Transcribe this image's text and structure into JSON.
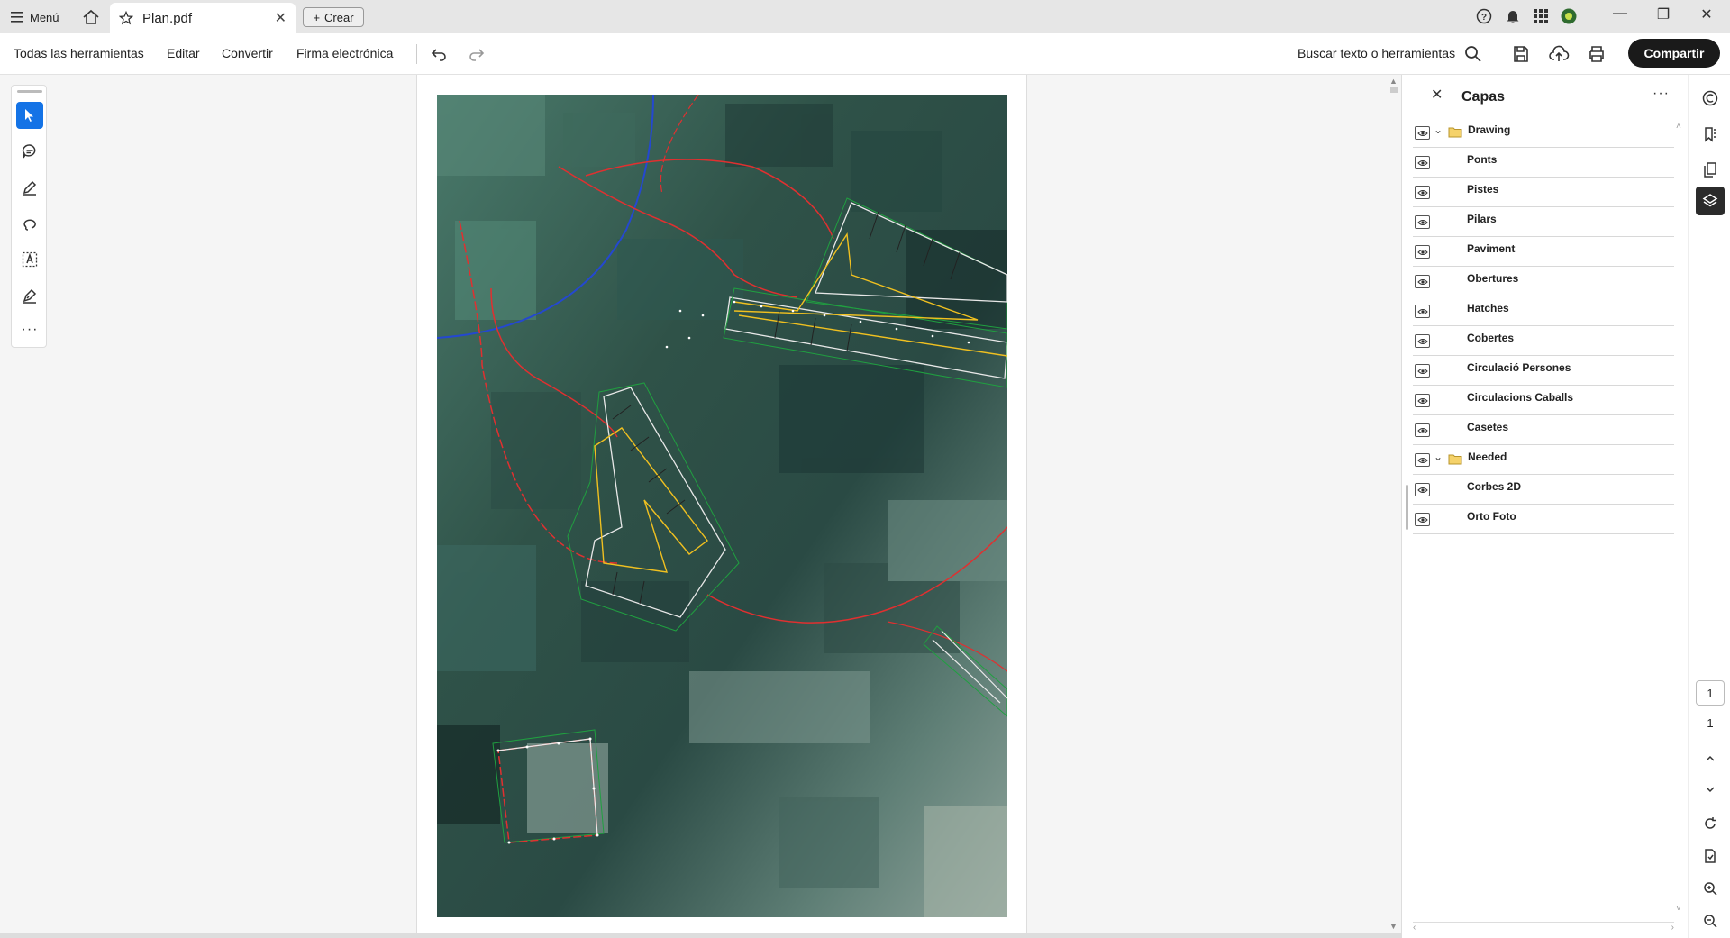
{
  "titlebar": {
    "menu_label": "Menú",
    "tab_title": "Plan.pdf",
    "create_label": "Crear"
  },
  "toolbar": {
    "all_tools": "Todas las herramientas",
    "edit": "Editar",
    "convert": "Convertir",
    "esign": "Firma electrónica",
    "search_label": "Buscar texto o herramientas",
    "share": "Compartir"
  },
  "layers_panel": {
    "title": "Capas",
    "items": [
      {
        "label": "Drawing",
        "group": true
      },
      {
        "label": "Ponts",
        "group": false
      },
      {
        "label": "Pistes",
        "group": false
      },
      {
        "label": "Pilars",
        "group": false
      },
      {
        "label": "Paviment",
        "group": false
      },
      {
        "label": "Obertures",
        "group": false
      },
      {
        "label": "Hatches",
        "group": false
      },
      {
        "label": "Cobertes",
        "group": false
      },
      {
        "label": "Circulació Persones",
        "group": false
      },
      {
        "label": "Circulacions Caballs",
        "group": false
      },
      {
        "label": "Casetes",
        "group": false
      },
      {
        "label": "Needed",
        "group": true
      },
      {
        "label": "Corbes 2D",
        "group": false
      },
      {
        "label": "Orto Foto",
        "group": false
      }
    ]
  },
  "page_nav": {
    "current_page": "1",
    "total_pages": "1"
  },
  "colors": {
    "accent": "#1473e6",
    "share_bg": "#1a1a1a",
    "line_red": "#e03030",
    "line_yellow": "#f0c020",
    "line_blue": "#2040c0",
    "line_white": "#e8e8e8",
    "line_green": "#20a040"
  }
}
